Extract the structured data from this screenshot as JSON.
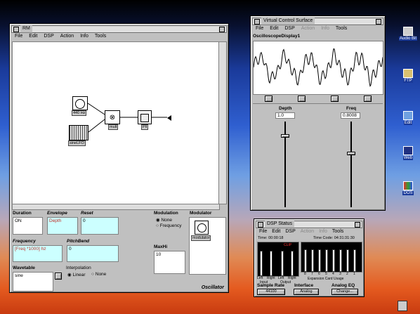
{
  "rm_window": {
    "title": "RM",
    "menu": [
      "File",
      "Edit",
      "DSP",
      "Action",
      "Info",
      "Tools"
    ],
    "nodes": {
      "osc_label": "440 Hz",
      "lfo_label": "sineLFO",
      "mult_label": "mult",
      "out_label": "Pll"
    },
    "fields": {
      "duration_label": "Duration",
      "duration_value": "ON",
      "envelope_label": "Envelope",
      "envelope_value": "Depth",
      "reset_label": "Reset",
      "reset_value": "0",
      "frequency_label": "Frequency",
      "frequency_value": "[Freq *1000] hz",
      "pitchbend_label": "PitchBend",
      "pitchbend_value": "0",
      "wavetable_label": "Wavetable",
      "wavetable_value": "sine",
      "interpolation_label": "Interpolation",
      "interp_linear": "Linear",
      "interp_none": "None",
      "modulation_label": "Modulation",
      "mod_none": "None",
      "mod_frequency": "Frequency",
      "modulator_label": "Modulator",
      "modulator_icon_label": "modulator",
      "maxhi_label": "MaxHi",
      "maxhi_value": "10",
      "footer": "Oscillator"
    }
  },
  "vcs_window": {
    "title": "Virtual Control Surface",
    "menu": [
      "File",
      "Edit",
      "DSP",
      "Action",
      "Info",
      "Tools"
    ],
    "display_title": "OscilloscopeDisplay1",
    "depth_label": "Depth",
    "depth_value": "1.0",
    "freq_label": "Freq",
    "freq_value": "0.8008",
    "depth_level": 1.0,
    "freq_level": 0.75
  },
  "dsp_window": {
    "title": "DSP Status",
    "menu": [
      "File",
      "Edit",
      "DSP",
      "Action",
      "Info",
      "Tools"
    ],
    "time_text": "Time: 00:00:18",
    "timecode_text": "Time Code: 04:31:31:30",
    "clip_label": "CLIP",
    "input_label": "Input",
    "output_label": "Output",
    "left_label": "Left",
    "right_label": "Right",
    "expansion_label": "Expansion Card Usage",
    "expansion_numbers": [
      "8",
      "7",
      "6",
      "5",
      "4",
      "3",
      "2",
      "1"
    ],
    "sample_rate_label": "Sample Rate",
    "sample_rate_value": "44100",
    "interface_label": "Interface",
    "interface_value": "Analog",
    "analog_eq_label": "Analog EQ",
    "analog_eq_value": "Change..."
  },
  "desktop_icons": [
    {
      "label": "Audio Bit"
    },
    {
      "label": "FTP"
    },
    {
      "label": "Edit"
    },
    {
      "label": "Web"
    },
    {
      "label": "DOS"
    }
  ],
  "colors": {
    "accent_pink": "#ccffff",
    "desktop_top": "#000000",
    "desktop_bottom": "#c83b10"
  }
}
